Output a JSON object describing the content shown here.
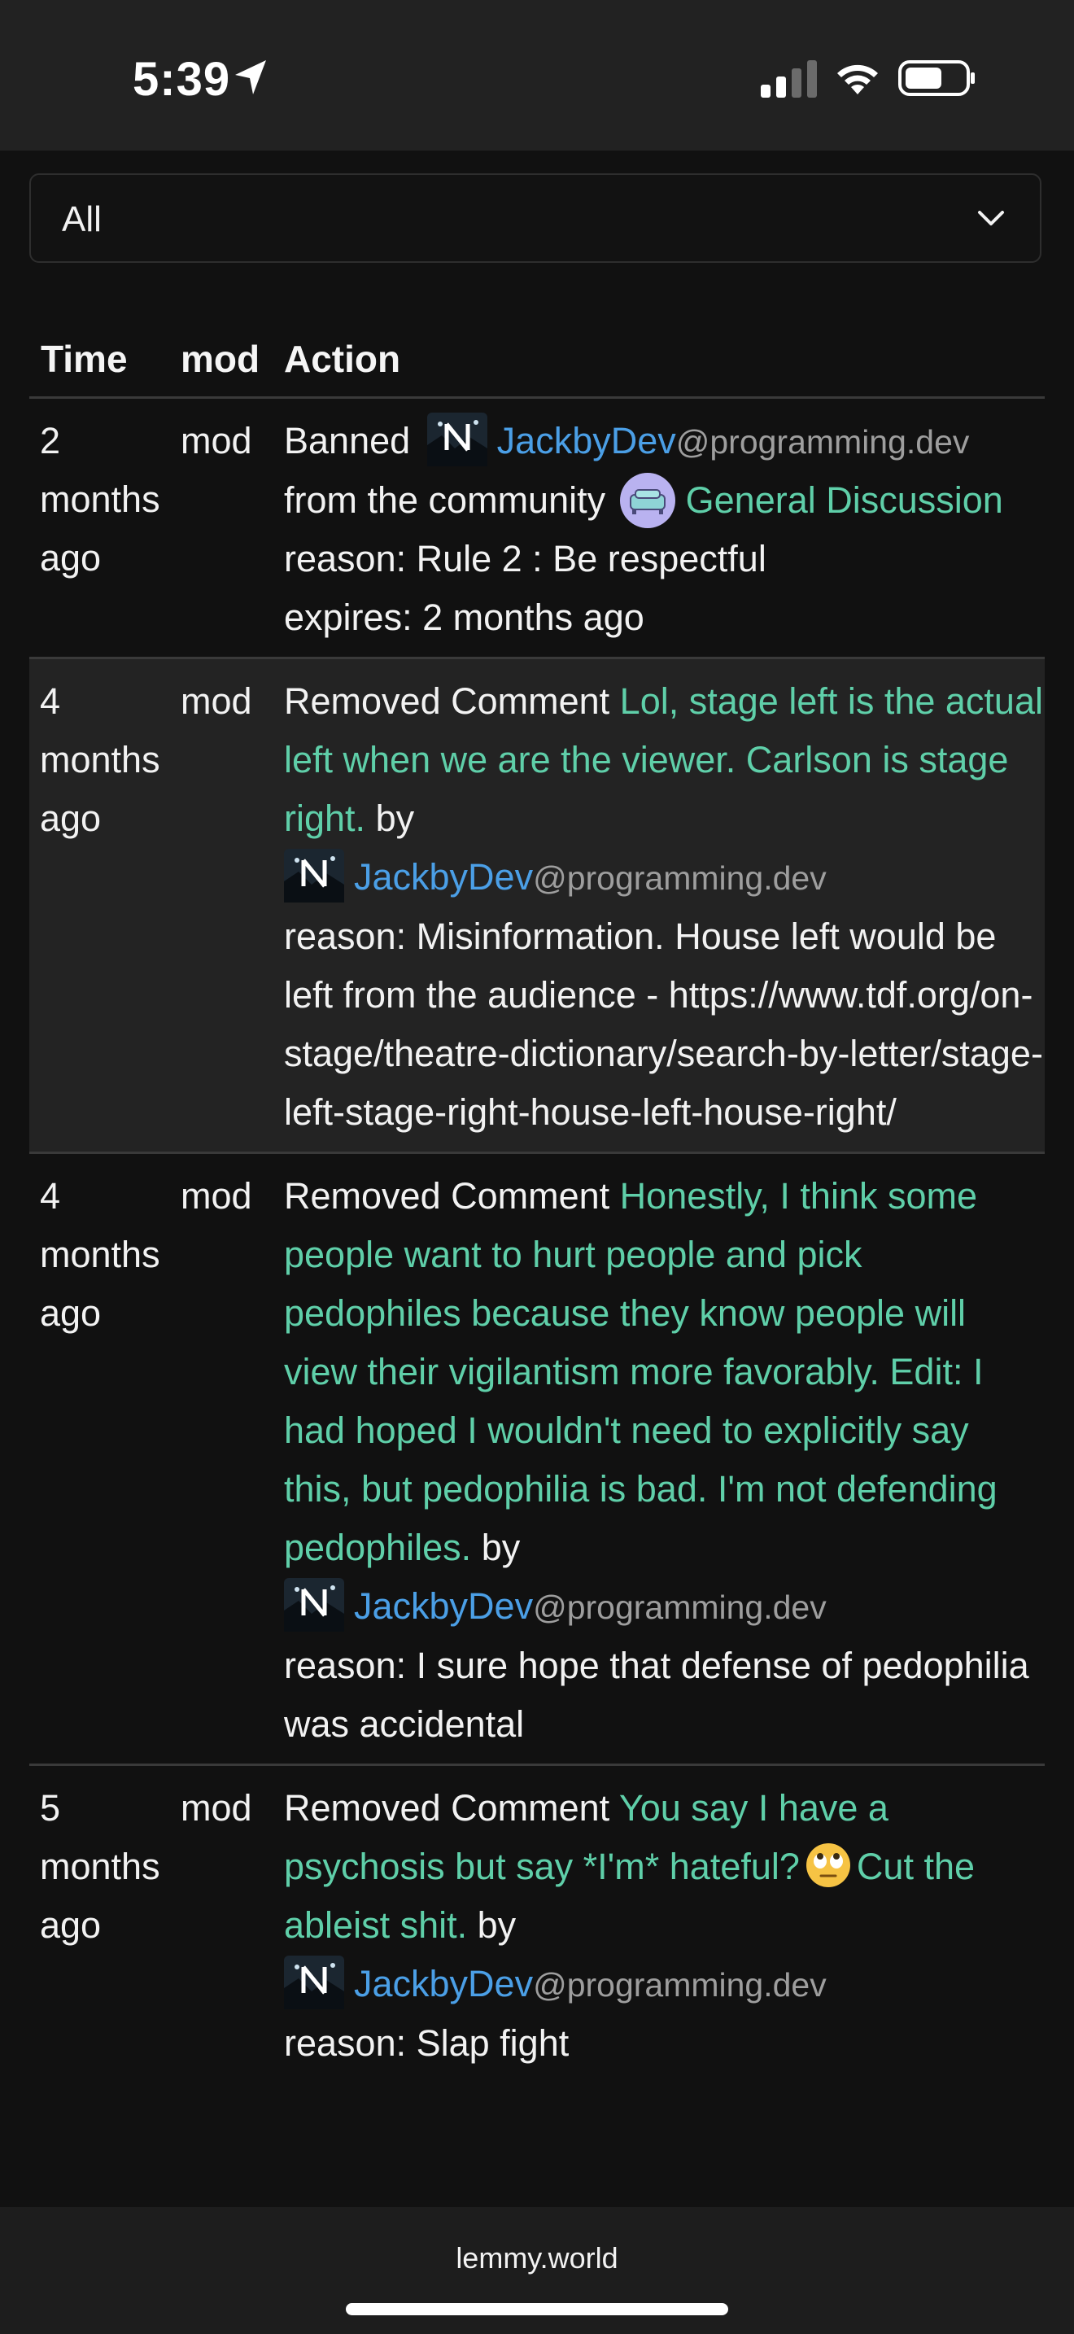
{
  "status_bar": {
    "time": "5:39"
  },
  "filter": {
    "selected": "All"
  },
  "table": {
    "headers": [
      "Time",
      "mod",
      "Action"
    ],
    "rows": [
      {
        "time": "2 months ago",
        "mod": "mod",
        "action": {
          "prefix": "Banned",
          "user": "JackbyDev",
          "user_domain": "@programming.dev",
          "from_text": "from the community",
          "community": "General Discussion",
          "reason": "reason: Rule 2 : Be respectful",
          "expires": "expires: 2 months ago"
        }
      },
      {
        "time": "4 months ago",
        "mod": "mod",
        "action": {
          "prefix": "Removed Comment",
          "comment": "Lol, stage left is the actual left when we are the viewer. Carlson is stage right.",
          "by": "by",
          "user": "JackbyDev",
          "user_domain": "@programming.dev",
          "reason": "reason: Misinformation. House left would be left from the audience - https://www.tdf.org/on-stage/theatre-dictionary/search-by-letter/stage-left-stage-right-house-left-house-right/"
        }
      },
      {
        "time": "4 months ago",
        "mod": "mod",
        "action": {
          "prefix": "Removed Comment",
          "comment": "Honestly, I think some people want to hurt people and pick pedophiles because they know people will view their vigilantism more favorably. Edit: I had hoped I wouldn't need to explicitly say this, but pedophilia is bad. I'm not defending pedophiles.",
          "by": "by",
          "user": "JackbyDev",
          "user_domain": "@programming.dev",
          "reason": "reason: I sure hope that defense of pedophilia was accidental"
        }
      },
      {
        "time": "5 months ago",
        "mod": "mod",
        "action": {
          "prefix": "Removed Comment",
          "comment_before_emoji": "You say I have a psychosis but say *I'm* hateful?",
          "emoji": "eye-roll-emoji",
          "comment_after_emoji": "Cut the ableist shit.",
          "by": "by",
          "user": "JackbyDev",
          "user_domain": "@programming.dev",
          "reason": "reason: Slap fight"
        }
      }
    ]
  },
  "footer": {
    "domain": "lemmy.world"
  },
  "colors": {
    "background": "#111111",
    "row_alt": "#232323",
    "link_green": "#5fcfa9",
    "link_blue": "#4b9fe6",
    "muted": "#9e9e9e"
  },
  "icons": [
    "location-arrow-icon",
    "cellular-signal-icon",
    "wifi-icon",
    "battery-icon",
    "chevron-down-icon",
    "user-avatar",
    "community-icon",
    "eye-roll-emoji"
  ]
}
